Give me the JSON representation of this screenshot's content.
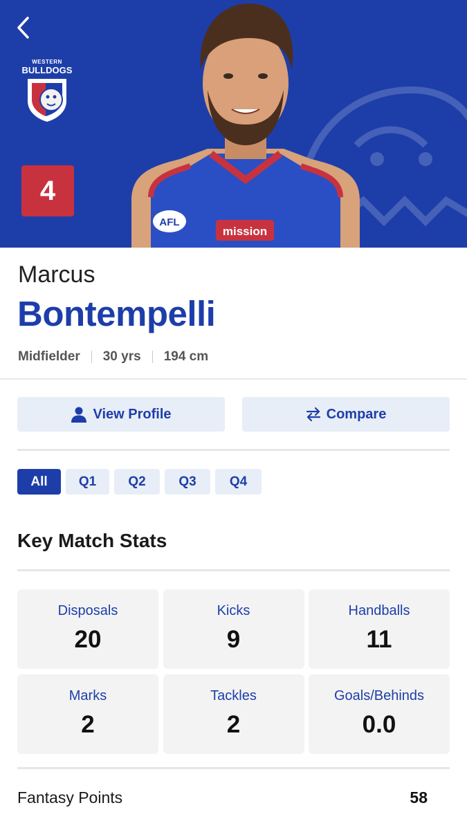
{
  "hero": {
    "club": {
      "line1": "WESTERN",
      "line2": "BULLDOGS"
    },
    "jersey_number": "4",
    "colors": {
      "brand": "#1d3ea9",
      "accent": "#c8323f"
    }
  },
  "player": {
    "first_name": "Marcus",
    "last_name": "Bontempelli",
    "position": "Midfielder",
    "age": "30 yrs",
    "height": "194 cm"
  },
  "actions": {
    "profile_label": "View Profile",
    "compare_label": "Compare"
  },
  "tabs": [
    {
      "label": "All",
      "active": true
    },
    {
      "label": "Q1",
      "active": false
    },
    {
      "label": "Q2",
      "active": false
    },
    {
      "label": "Q3",
      "active": false
    },
    {
      "label": "Q4",
      "active": false
    }
  ],
  "key_stats": {
    "title": "Key Match Stats",
    "items": [
      {
        "label": "Disposals",
        "value": "20"
      },
      {
        "label": "Kicks",
        "value": "9"
      },
      {
        "label": "Handballs",
        "value": "11"
      },
      {
        "label": "Marks",
        "value": "2"
      },
      {
        "label": "Tackles",
        "value": "2"
      },
      {
        "label": "Goals/Behinds",
        "value": "0.0"
      }
    ]
  },
  "fantasy": {
    "label": "Fantasy Points",
    "value": "58"
  },
  "icons": {
    "back": "chevron-left-icon",
    "profile": "user-icon",
    "compare": "swap-arrows-icon"
  }
}
